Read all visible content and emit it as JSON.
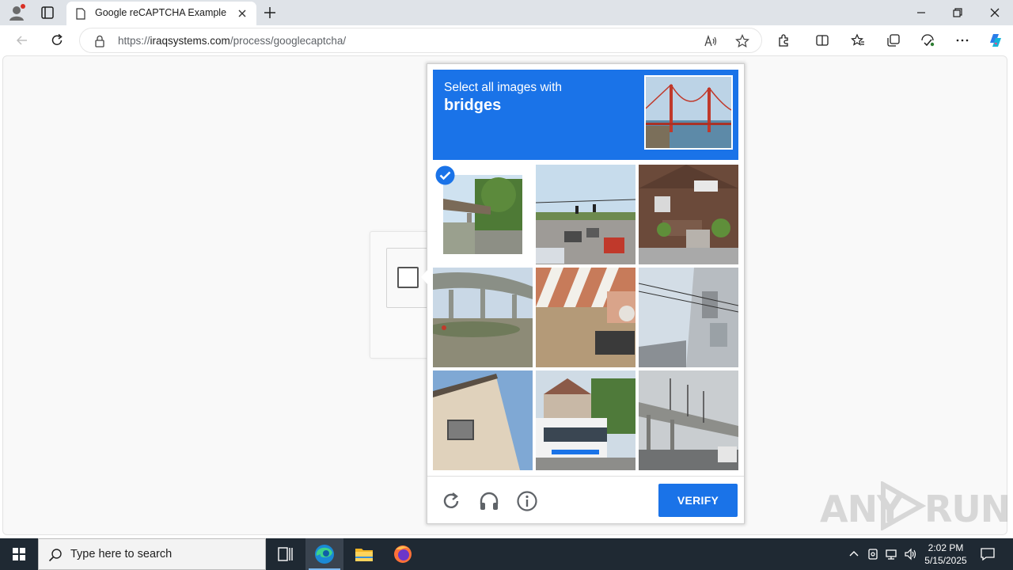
{
  "browser": {
    "tab_title": "Google reCAPTCHA Example",
    "url_prefix": "https://",
    "url_domain": "iraqsystems.com",
    "url_path": "/process/googlecaptcha/"
  },
  "captcha": {
    "instruction_line1": "Select all images with",
    "instruction_target": "bridges",
    "verify_label": "VERIFY",
    "tiles": [
      {
        "subject": "road overpass with trees",
        "selected": true
      },
      {
        "subject": "highway traffic lights",
        "selected": false
      },
      {
        "subject": "brick house",
        "selected": false
      },
      {
        "subject": "concrete overpass",
        "selected": false
      },
      {
        "subject": "red white barrier and motorbike",
        "selected": false
      },
      {
        "subject": "building with wires",
        "selected": false
      },
      {
        "subject": "building wall and window",
        "selected": false
      },
      {
        "subject": "white bus",
        "selected": false
      },
      {
        "subject": "elevated highway",
        "selected": false
      }
    ],
    "accent_color": "#1a73e8"
  },
  "watermark": {
    "text_left": "ANY",
    "text_right": "RUN"
  },
  "taskbar": {
    "search_placeholder": "Type here to search",
    "time": "2:02 PM",
    "date": "5/15/2025"
  }
}
